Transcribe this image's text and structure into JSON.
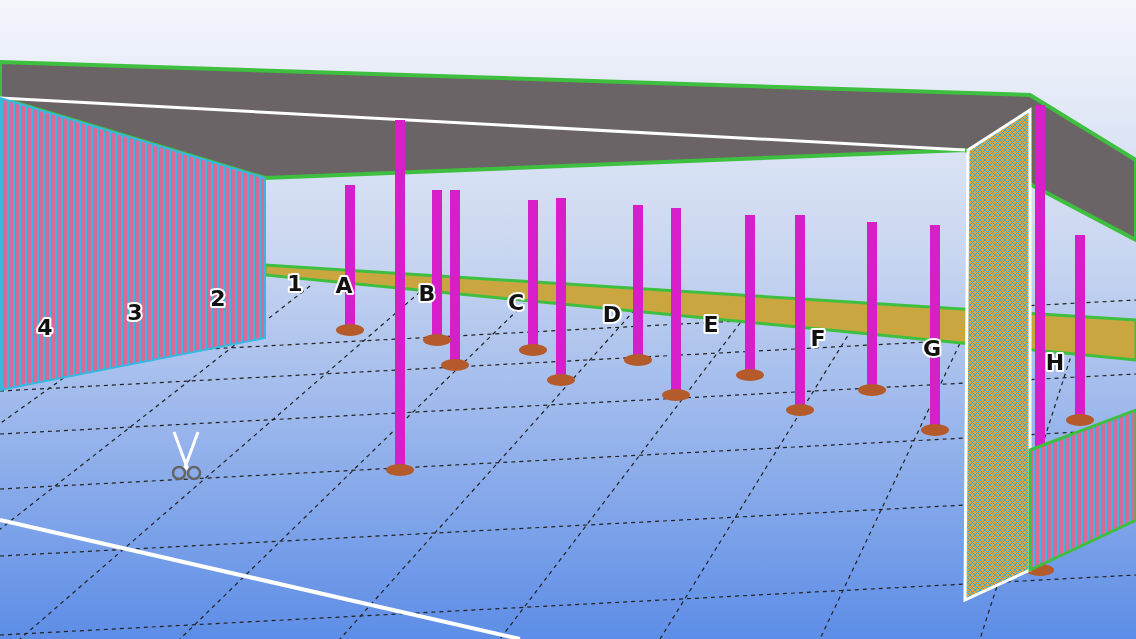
{
  "viewport": {
    "grid_labels": [
      {
        "label": "4"
      },
      {
        "label": "3"
      },
      {
        "label": "2"
      },
      {
        "label": "1"
      },
      {
        "label": "A"
      },
      {
        "label": "B"
      },
      {
        "label": "C"
      },
      {
        "label": "D"
      },
      {
        "label": "E"
      },
      {
        "label": "F"
      },
      {
        "label": "G"
      },
      {
        "label": "H"
      }
    ]
  }
}
